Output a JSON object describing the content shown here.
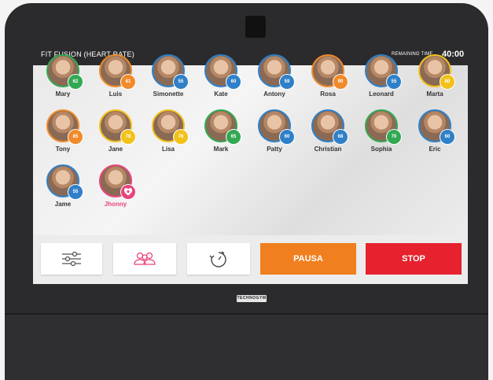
{
  "header": {
    "title": "FIT FUSION (HEART RATE)",
    "remaining_label": "REMAINING TIME",
    "remaining_value": "40:00"
  },
  "colors": {
    "green": "#33a853",
    "blue": "#2f80c8",
    "orange": "#f08a2a",
    "yellow": "#f2c21b",
    "pink": "#e8457a",
    "pausa": "#f07f1f",
    "stop": "#e6222e"
  },
  "athletes": [
    {
      "name": "Mary",
      "hr": "62",
      "color": "green"
    },
    {
      "name": "Luis",
      "hr": "81",
      "color": "orange"
    },
    {
      "name": "Simonette",
      "hr": "55",
      "color": "blue"
    },
    {
      "name": "Kate",
      "hr": "60",
      "color": "blue"
    },
    {
      "name": "Antony",
      "hr": "59",
      "color": "blue"
    },
    {
      "name": "Rosa",
      "hr": "90",
      "color": "orange"
    },
    {
      "name": "Leonard",
      "hr": "55",
      "color": "blue"
    },
    {
      "name": "Marta",
      "hr": "80",
      "color": "yellow"
    },
    {
      "name": "Tony",
      "hr": "85",
      "color": "orange"
    },
    {
      "name": "Jane",
      "hr": "78",
      "color": "yellow"
    },
    {
      "name": "Lisa",
      "hr": "76",
      "color": "yellow"
    },
    {
      "name": "Mark",
      "hr": "65",
      "color": "green"
    },
    {
      "name": "Patty",
      "hr": "60",
      "color": "blue"
    },
    {
      "name": "Christian",
      "hr": "68",
      "color": "blue"
    },
    {
      "name": "Sophia",
      "hr": "70",
      "color": "green"
    },
    {
      "name": "Eric",
      "hr": "60",
      "color": "blue"
    },
    {
      "name": "Jame",
      "hr": "55",
      "color": "blue"
    },
    {
      "name": "Jhonny",
      "hr": "",
      "color": "pink",
      "icon": "heart-plus-icon"
    }
  ],
  "controls": {
    "settings_icon": "sliders-icon",
    "group_icon": "group-icon",
    "timer_icon": "timer-icon",
    "pausa_label": "PAUSA",
    "stop_label": "STOP"
  },
  "brand": {
    "logo": "TECHNOGYM"
  }
}
